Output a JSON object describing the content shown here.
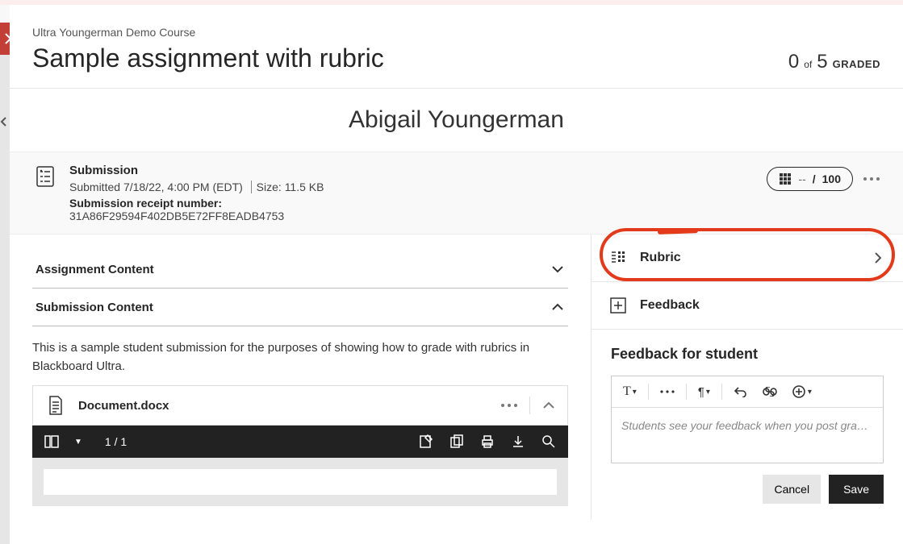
{
  "header": {
    "course": "Ultra Youngerman Demo Course",
    "title": "Sample assignment with rubric",
    "graded_current": "0",
    "graded_of": "of",
    "graded_total": "5",
    "graded_label": "GRADED"
  },
  "student_name": "Abigail Youngerman",
  "submission": {
    "label": "Submission",
    "submitted_prefix": "Submitted",
    "timestamp": "7/18/22, 4:00 PM (EDT)",
    "size_prefix": "Size:",
    "size": "11.5 KB",
    "receipt_label": "Submission receipt number:",
    "receipt": "31A86F29594F402DB5E72FF8EADB4753"
  },
  "grade_pill": {
    "current": "--",
    "sep": "/",
    "max": "100"
  },
  "accordions": {
    "assignment_content": "Assignment Content",
    "submission_content": "Submission Content"
  },
  "submission_text": "This is a sample student submission for the purposes of showing how to grade with rubrics in Blackboard Ultra.",
  "document": {
    "filename": "Document.docx",
    "page_indicator": "1 / 1"
  },
  "side": {
    "rubric": "Rubric",
    "feedback": "Feedback"
  },
  "feedback_panel": {
    "title": "Feedback for student",
    "placeholder": "Students see your feedback when you post gra…",
    "cancel": "Cancel",
    "save": "Save"
  }
}
